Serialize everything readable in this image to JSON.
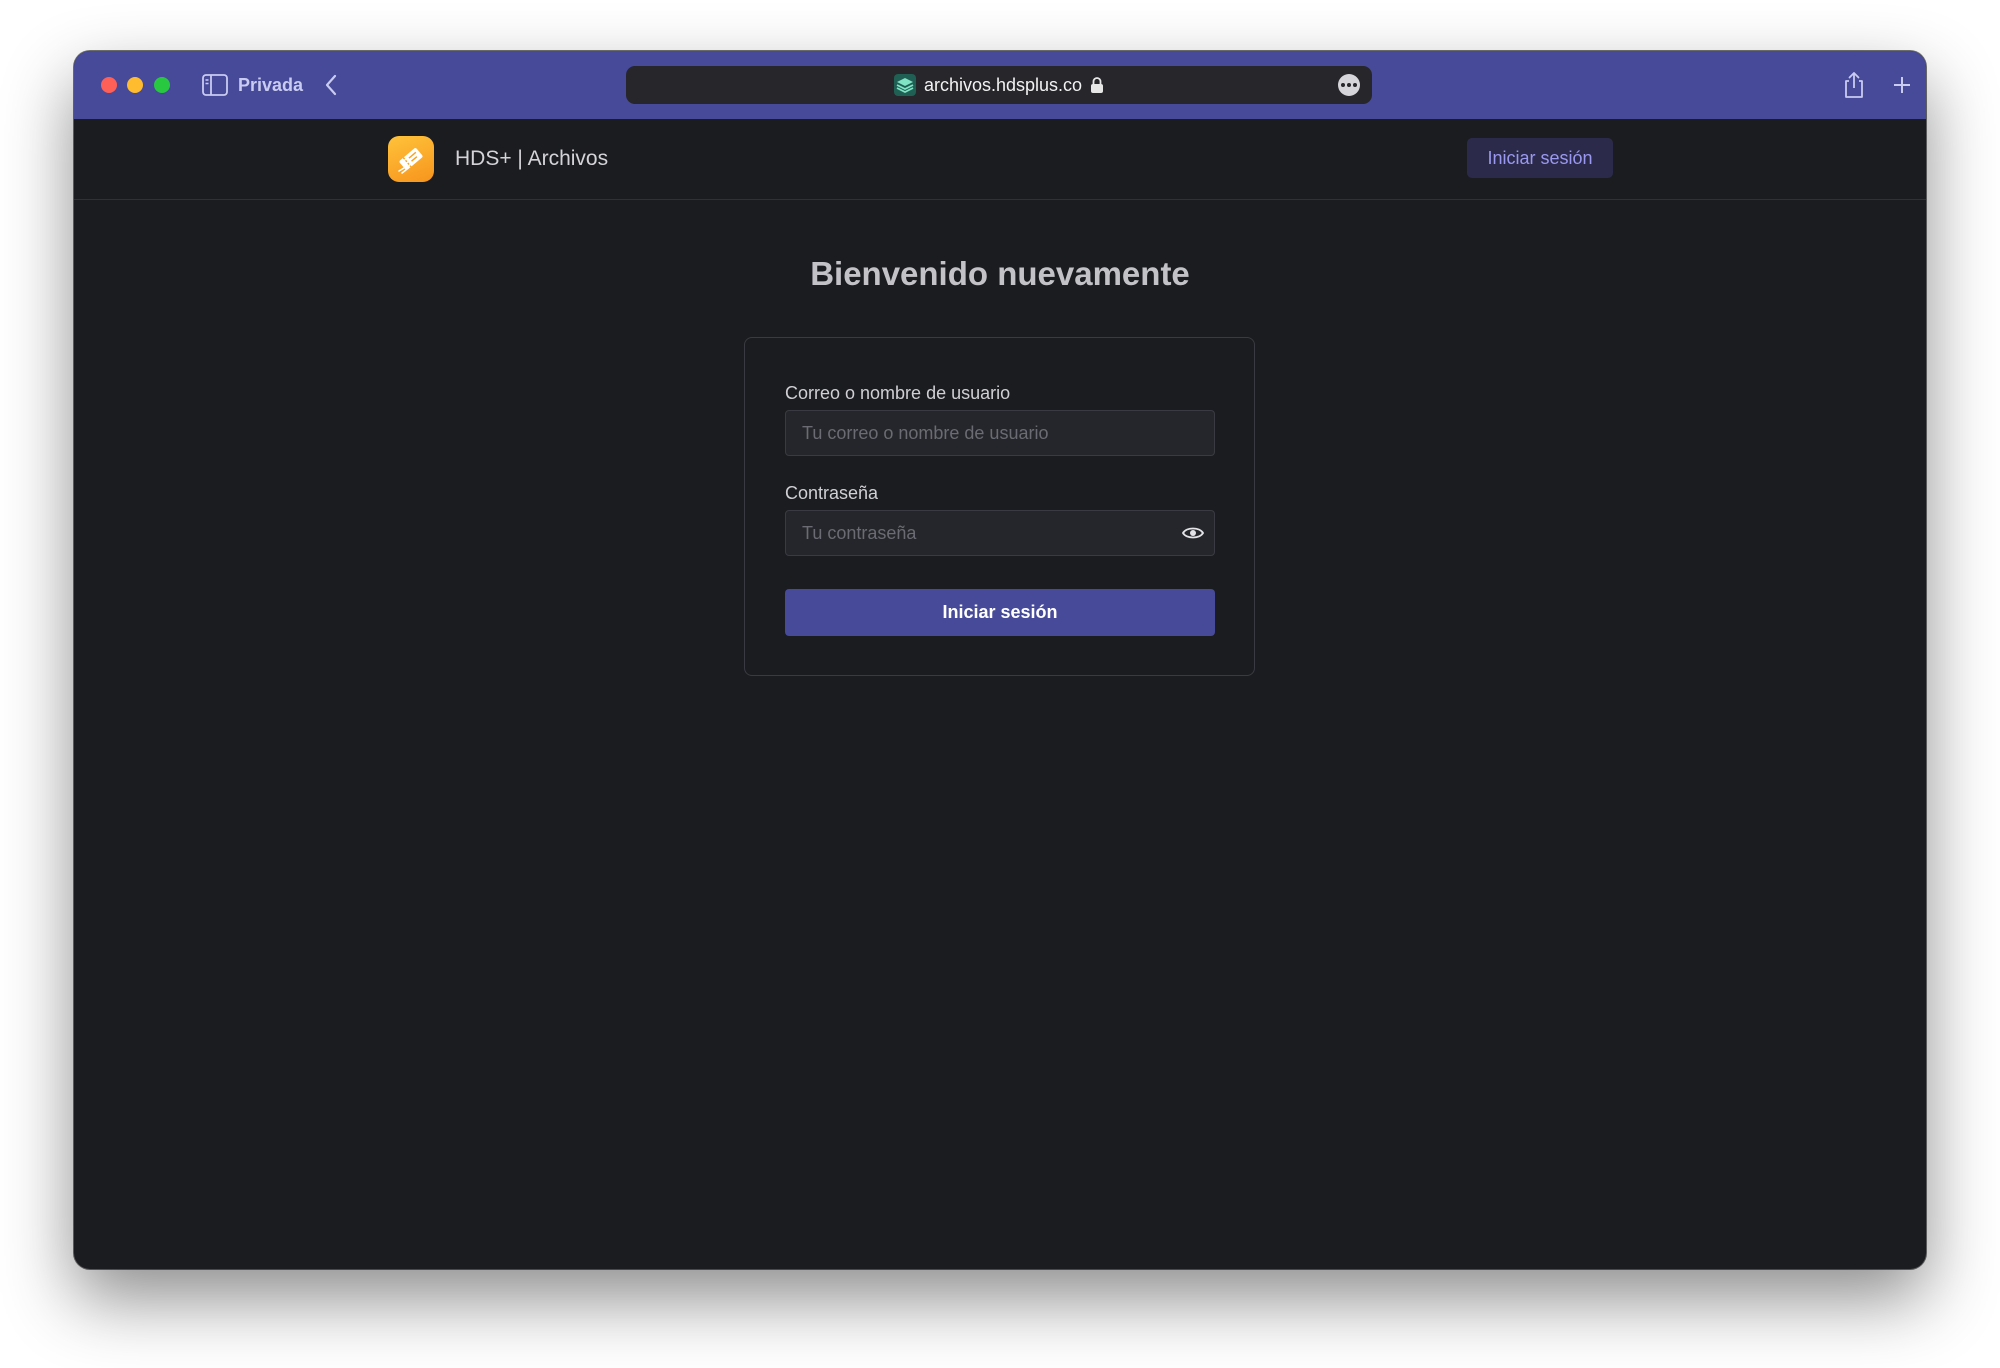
{
  "browser": {
    "private_label": "Privada",
    "url": "archivos.hdsplus.co",
    "colors": {
      "titlebar": "#464a99",
      "addressbar": "#26262b"
    }
  },
  "header": {
    "app_title": "HDS+ | Archivos",
    "login_label": "Iniciar sesión",
    "logo_icon": "ticket-icon"
  },
  "main": {
    "heading": "Bienvenido nuevamente",
    "form": {
      "user_label": "Correo o nombre de usuario",
      "user_placeholder": "Tu correo o nombre de usuario",
      "user_value": "",
      "password_label": "Contraseña",
      "password_placeholder": "Tu contraseña",
      "password_value": "",
      "submit_label": "Iniciar sesión"
    }
  },
  "colors": {
    "background": "#1b1c20",
    "accent": "#464a99",
    "logo": "#f7a21b"
  }
}
